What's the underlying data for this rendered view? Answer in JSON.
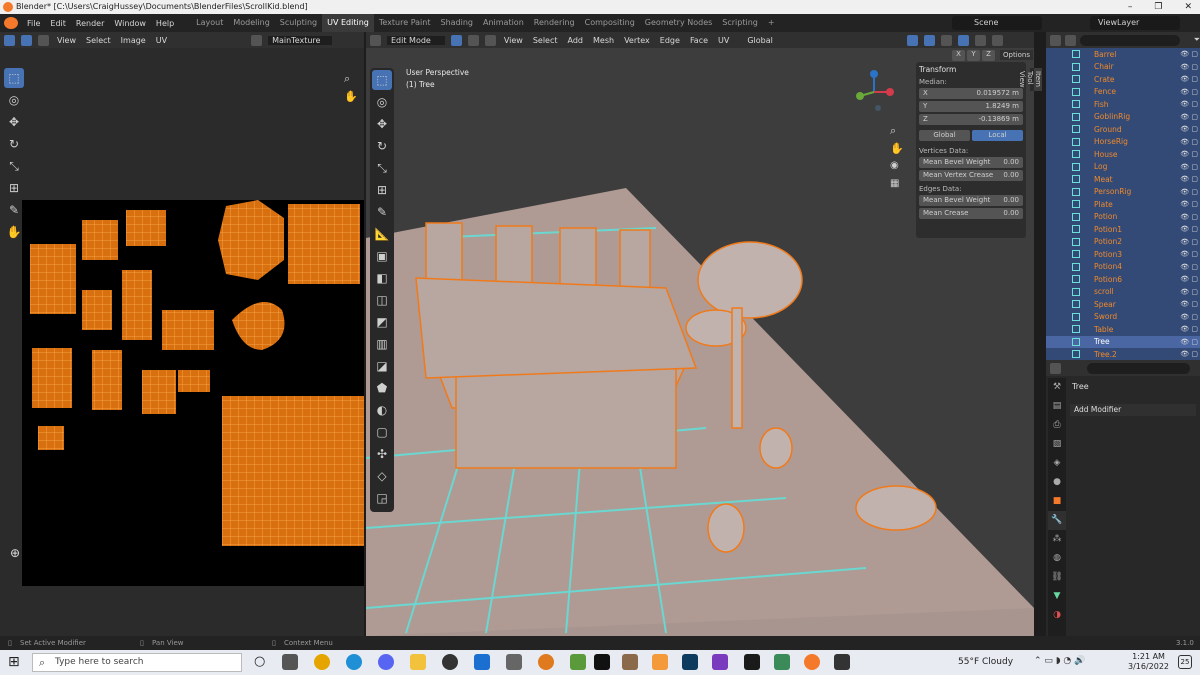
{
  "window": {
    "title": "Blender* [C:\\Users\\CraigHussey\\Documents\\BlenderFiles\\ScrollKid.blend]",
    "controls": [
      "–",
      "❐",
      "✕"
    ]
  },
  "menu": {
    "items": [
      "File",
      "Edit",
      "Render",
      "Window",
      "Help"
    ],
    "workspaces": [
      "Layout",
      "Modeling",
      "Sculpting",
      "UV Editing",
      "Texture Paint",
      "Shading",
      "Animation",
      "Rendering",
      "Compositing",
      "Geometry Nodes",
      "Scripting"
    ],
    "active_workspace": "UV Editing",
    "scene": "Scene",
    "view_layer": "ViewLayer"
  },
  "uv": {
    "menus": [
      "View",
      "Select",
      "Image",
      "UV"
    ],
    "image": "MainTexture"
  },
  "viewport": {
    "mode": "Edit Mode",
    "menus": [
      "View",
      "Select",
      "Add",
      "Mesh",
      "Vertex",
      "Edge",
      "Face",
      "UV"
    ],
    "orientation": "Global",
    "options": "Options",
    "overlay_title": "User Perspective",
    "overlay_sub": "(1) Tree",
    "gizmo_axes": [
      "X",
      "Y",
      "Z"
    ],
    "side_tabs": [
      "Item",
      "Tool",
      "View"
    ]
  },
  "transform": {
    "title": "Transform",
    "median": "Median:",
    "x_label": "X",
    "x": "0.019572 m",
    "y_label": "Y",
    "y": "1.8249 m",
    "z_label": "Z",
    "z": "-0.13869 m",
    "global": "Global",
    "local": "Local",
    "vertices_label": "Vertices Data:",
    "v_bevel": "Mean Bevel Weight",
    "v_bevel_val": "0.00",
    "v_crease": "Mean Vertex Crease",
    "v_crease_val": "0.00",
    "edges_label": "Edges Data:",
    "e_bevel": "Mean Bevel Weight",
    "e_bevel_val": "0.00",
    "e_crease": "Mean Crease",
    "e_crease_val": "0.00"
  },
  "outliner": {
    "items": [
      "Barrel",
      "Chair",
      "Crate",
      "Fence",
      "Fish",
      "GoblinRig",
      "Ground",
      "HorseRig",
      "House",
      "Log",
      "Meat",
      "PersonRig",
      "Plate",
      "Potion",
      "Potion1",
      "Potion2",
      "Potion3",
      "Potion4",
      "Potion6",
      "scroll",
      "Spear",
      "Sword",
      "Table",
      "Tree",
      "Tree.2"
    ],
    "selected": "Tree"
  },
  "properties": {
    "object": "Tree",
    "add_modifier": "Add Modifier"
  },
  "status": {
    "left": "Set Active Modifier",
    "middle": "Pan View",
    "right": "Context Menu",
    "version": "3.1.0"
  },
  "taskbar": {
    "search": "Type here to search",
    "weather": "55°F  Cloudy",
    "time": "1:21 AM",
    "date": "3/16/2022",
    "badge": "25"
  },
  "colors": {
    "accent": "#4772b3",
    "orange": "#f5792a",
    "cyan": "#6ae0d8"
  }
}
